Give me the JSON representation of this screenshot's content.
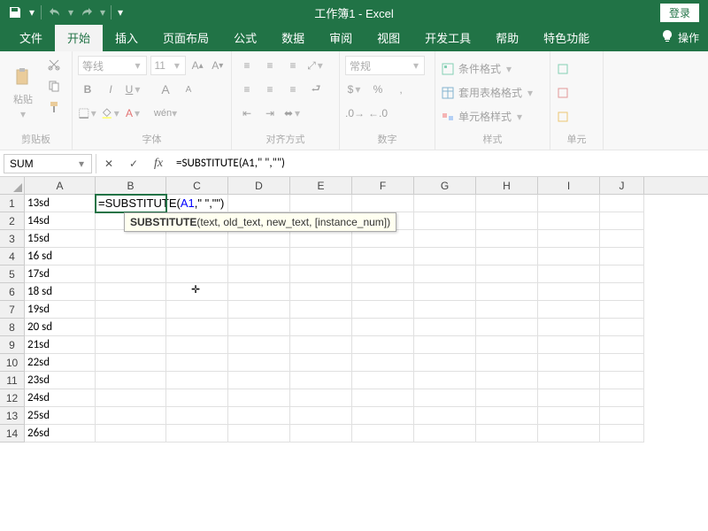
{
  "titlebar": {
    "title": "工作簿1 - Excel",
    "login": "登录"
  },
  "tabs": {
    "file": "文件",
    "home": "开始",
    "insert": "插入",
    "layout": "页面布局",
    "formulas": "公式",
    "data": "数据",
    "review": "审阅",
    "view": "视图",
    "dev": "开发工具",
    "help": "帮助",
    "special": "特色功能",
    "tellme": "操作"
  },
  "ribbon": {
    "clipboard": {
      "paste": "粘贴",
      "label": "剪贴板"
    },
    "font": {
      "name": "等线",
      "size": "11",
      "label": "字体"
    },
    "align": {
      "label": "对齐方式"
    },
    "number": {
      "format": "常规",
      "label": "数字"
    },
    "styles": {
      "cond": "条件格式",
      "table": "套用表格格式",
      "cell": "单元格样式",
      "label": "样式"
    },
    "cells": {
      "label": "单元"
    }
  },
  "fbar": {
    "namebox": "SUM",
    "formula": "=SUBSTITUTE(A1,\" \",\"\")"
  },
  "grid": {
    "cols": [
      "A",
      "B",
      "C",
      "D",
      "E",
      "F",
      "G",
      "H",
      "I",
      "J"
    ],
    "rows": [
      {
        "n": 1,
        "A": "13sd",
        "B": "=SUBSTITUTE(A1,\" \",\"\")"
      },
      {
        "n": 2,
        "A": "14sd"
      },
      {
        "n": 3,
        "A": "15sd"
      },
      {
        "n": 4,
        "A": "16 sd"
      },
      {
        "n": 5,
        "A": "17sd"
      },
      {
        "n": 6,
        "A": "18   sd"
      },
      {
        "n": 7,
        "A": "19sd"
      },
      {
        "n": 8,
        "A": "20 sd"
      },
      {
        "n": 9,
        "A": "21sd"
      },
      {
        "n": 10,
        "A": "22sd"
      },
      {
        "n": 11,
        "A": "23sd"
      },
      {
        "n": 12,
        "A": "24sd"
      },
      {
        "n": 13,
        "A": "25sd"
      },
      {
        "n": 14,
        "A": "26sd"
      }
    ],
    "active_cell": "B1",
    "tooltip_fn": "SUBSTITUTE",
    "tooltip_args": "(text, old_text, new_text, [instance_num])"
  }
}
